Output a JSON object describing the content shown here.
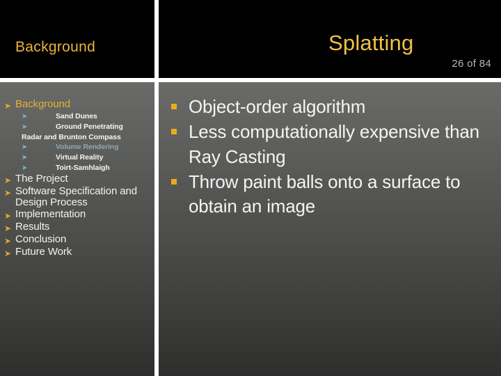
{
  "header": {
    "sidebar_title": "Background",
    "slide_title": "Splatting",
    "counter": "26 of 84"
  },
  "sidebar": {
    "items": [
      {
        "label": "Background",
        "level": 1,
        "accent": true,
        "arrow": "➤"
      },
      {
        "label": "Sand Dunes",
        "level": 2,
        "arrow": "➤"
      },
      {
        "label": "Ground Penetrating",
        "level": 2,
        "arrow": "➤"
      },
      {
        "label": "Radar  and Brunton Compass",
        "level": 2,
        "continuation": true
      },
      {
        "label": "Volume Rendering",
        "level": 2,
        "dim": true,
        "arrow": "➤"
      },
      {
        "label": "Virtual Reality",
        "level": 2,
        "arrow": "➤"
      },
      {
        "label": "Toirt-Samhlaigh",
        "level": 2,
        "arrow": "➤"
      },
      {
        "label": "The Project",
        "level": 1,
        "arrow": "➤"
      },
      {
        "label": "Software Specification and Design Process",
        "level": 1,
        "arrow": "➤"
      },
      {
        "label": "Implementation",
        "level": 1,
        "arrow": "➤"
      },
      {
        "label": "Results",
        "level": 1,
        "arrow": "➤"
      },
      {
        "label": "Conclusion",
        "level": 1,
        "arrow": "➤"
      },
      {
        "label": "Future Work",
        "level": 1,
        "arrow": "➤"
      }
    ]
  },
  "main": {
    "bullets": [
      "Object-order algorithm",
      "Less computationally expensive than Ray Casting",
      "Throw paint balls onto a surface to obtain an image"
    ]
  },
  "colors": {
    "title_gold": "#f0c149",
    "header_gold": "#e8b43a",
    "bullet_marker": "#edab1c",
    "sub_arrow_blue": "#7fb8d4",
    "dim_text": "#8fa8b3",
    "counter_gray": "#b7b7b7",
    "header_bg": "#000000",
    "panel_top": "#6a6a68",
    "panel_bottom": "#2e2e2c"
  }
}
